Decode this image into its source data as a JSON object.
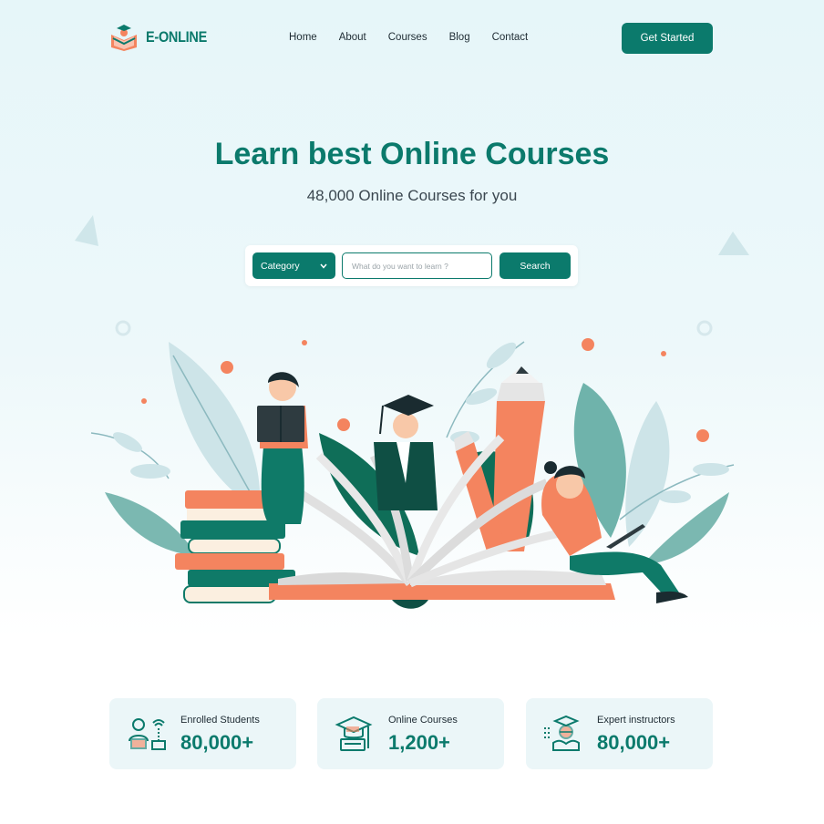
{
  "brand": {
    "name": "E-ONLINE"
  },
  "nav": {
    "home": "Home",
    "about": "About",
    "courses": "Courses",
    "blog": "Blog",
    "contact": "Contact"
  },
  "header": {
    "cta_label": "Get Started"
  },
  "hero": {
    "title": "Learn best Online Courses",
    "subtitle": "48,000 Online Courses for you"
  },
  "search": {
    "category_label": "Category",
    "placeholder": "What do you want to learn ?",
    "value": "",
    "button_label": "Search"
  },
  "stats": [
    {
      "label": "Enrolled Students",
      "value": "80,000+",
      "icon": "student-laptop-icon"
    },
    {
      "label": "Online Courses",
      "value": "1,200+",
      "icon": "graduation-computer-icon"
    },
    {
      "label": "Expert instructors",
      "value": "80,000+",
      "icon": "instructor-globe-icon"
    }
  ],
  "colors": {
    "primary": "#0b7a6c",
    "accent": "#f4845f",
    "hero_bg": "#e6f6f9",
    "stat_bg": "#ebf6f8"
  }
}
